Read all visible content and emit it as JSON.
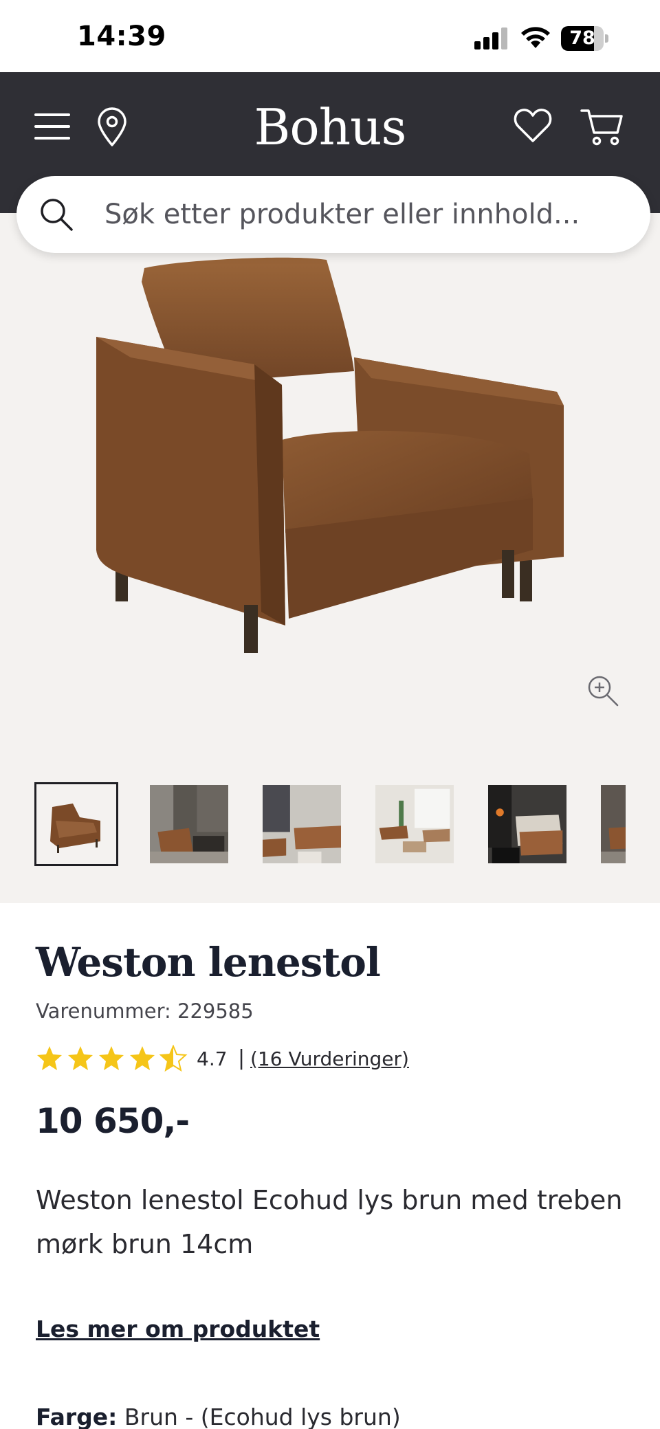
{
  "status_bar": {
    "time": "14:39",
    "battery_level": "78",
    "signal_bars": 3,
    "signal_bars_total": 4
  },
  "header": {
    "logo": "Bohus",
    "icons": [
      "menu-icon",
      "location-icon",
      "heart-icon",
      "cart-icon"
    ],
    "background_color": "#2f2f35"
  },
  "search": {
    "placeholder": "Søk etter produkter eller innhold..."
  },
  "gallery": {
    "thumbnail_count": 6,
    "selected_index": 0,
    "zoom_icon": "zoom-in-icon"
  },
  "product": {
    "name": "Weston lenestol",
    "sku_label": "Varenummer: 229585",
    "rating": {
      "stars": 4.5,
      "value": "4.7",
      "separator": "|",
      "reviews_link": "(16 Vurderinger)",
      "star_color": "#f5c518"
    },
    "price": "10 650,-",
    "description": "Weston lenestol Ecohud lys brun med treben mørk brun 14cm",
    "read_more": "Les mer om produktet",
    "color_label": "Farge:",
    "color_value": "Brun - (Ecohud lys brun)"
  }
}
